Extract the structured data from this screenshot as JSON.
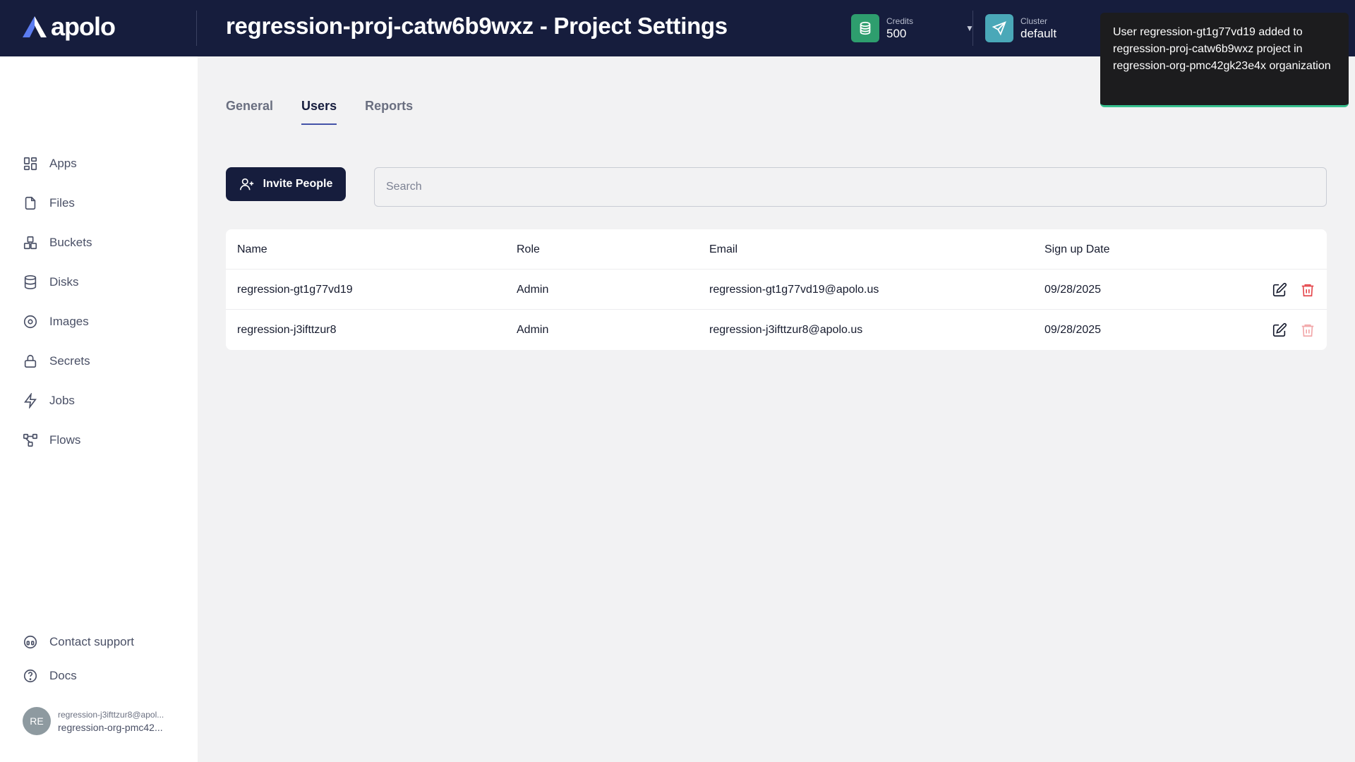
{
  "header": {
    "logo_text": "apolo",
    "title": "regression-proj-catw6b9wxz - Project Settings",
    "credits": {
      "label": "Credits",
      "value": "500",
      "icon": "coins-icon",
      "color": "#2e9e6e"
    },
    "cluster": {
      "label": "Cluster",
      "value": "default",
      "icon": "send-icon",
      "color": "#4aa8b8"
    }
  },
  "sidebar": {
    "items": [
      {
        "label": "Apps",
        "icon": "grid-icon"
      },
      {
        "label": "Files",
        "icon": "file-icon"
      },
      {
        "label": "Buckets",
        "icon": "buckets-icon"
      },
      {
        "label": "Disks",
        "icon": "database-icon"
      },
      {
        "label": "Images",
        "icon": "disc-icon"
      },
      {
        "label": "Secrets",
        "icon": "lock-icon"
      },
      {
        "label": "Jobs",
        "icon": "zap-icon"
      },
      {
        "label": "Flows",
        "icon": "flow-icon"
      }
    ],
    "bottom": [
      {
        "label": "Contact support",
        "icon": "headset-icon"
      },
      {
        "label": "Docs",
        "icon": "help-circle-icon"
      }
    ],
    "user": {
      "initials": "RE",
      "email": "regression-j3ifttzur8@apol...",
      "org": "regression-org-pmc42..."
    }
  },
  "tabs": [
    {
      "label": "General",
      "active": false
    },
    {
      "label": "Users",
      "active": true
    },
    {
      "label": "Reports",
      "active": false
    }
  ],
  "toolbar": {
    "invite_label": "Invite People",
    "search_placeholder": "Search"
  },
  "table": {
    "columns": [
      "Name",
      "Role",
      "Email",
      "Sign up Date"
    ],
    "rows": [
      {
        "name": "regression-gt1g77vd19",
        "role": "Admin",
        "email": "regression-gt1g77vd19@apolo.us",
        "date": "09/28/2025",
        "delete_enabled": true
      },
      {
        "name": "regression-j3ifttzur8",
        "role": "Admin",
        "email": "regression-j3ifttzur8@apolo.us",
        "date": "09/28/2025",
        "delete_enabled": false
      }
    ]
  },
  "toast": {
    "message": "User regression-gt1g77vd19 added to regression-proj-catw6b9wxz project in regression-org-pmc42gk23e4x organization"
  },
  "colors": {
    "header_bg": "#161d3d",
    "accent": "#4453a8",
    "danger": "#e5484d",
    "success": "#37c18f"
  }
}
